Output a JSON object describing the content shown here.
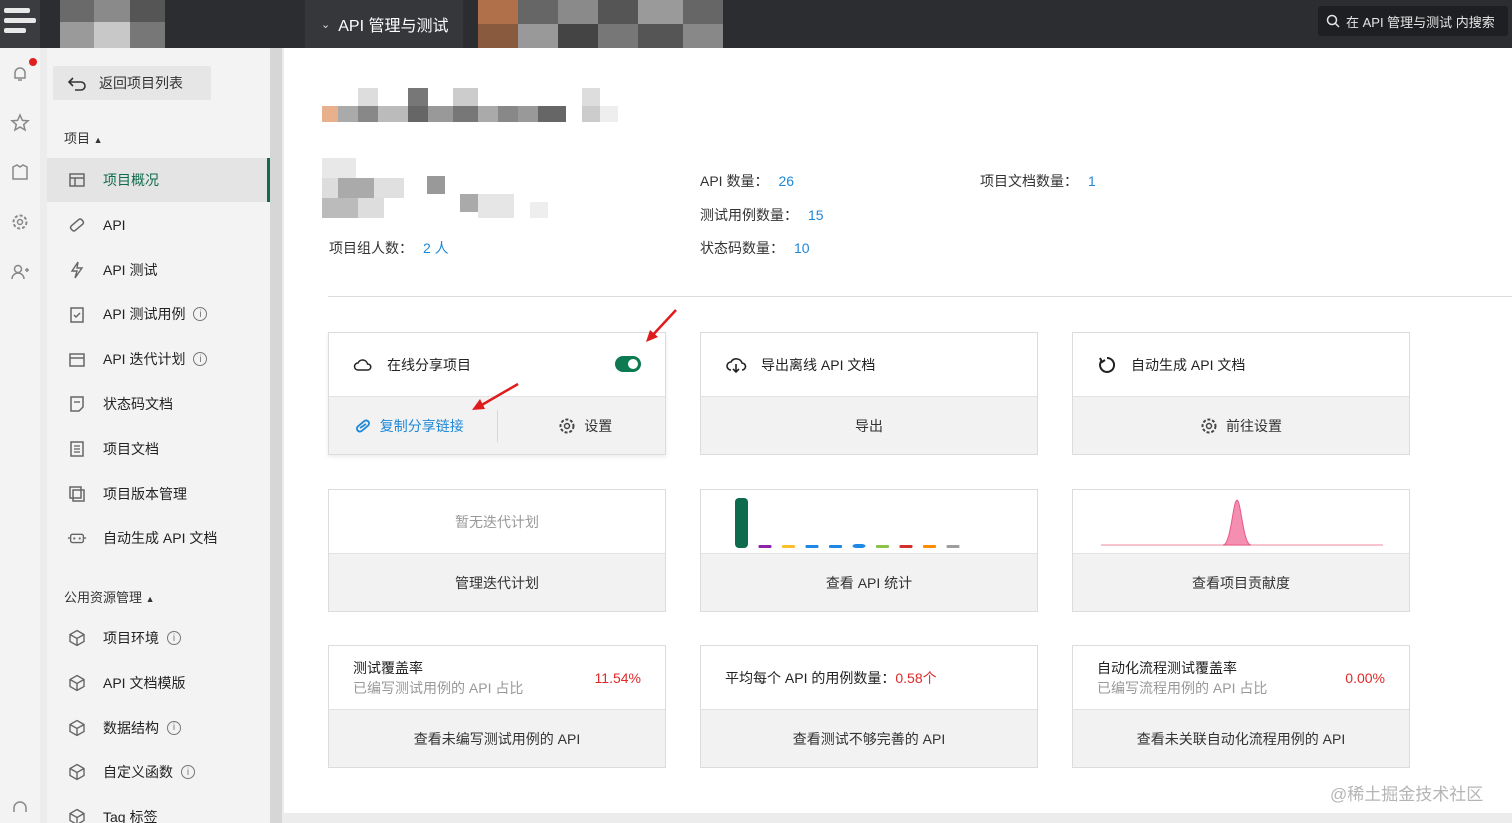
{
  "topbar": {
    "project_title": "API 管理与测试",
    "search_placeholder": "在 API 管理与测试 内搜索"
  },
  "sidebar": {
    "back_label": "返回项目列表",
    "section_project": "项目",
    "project_items": [
      {
        "label": "项目概况",
        "icon": "overview-icon",
        "active": true,
        "info": false
      },
      {
        "label": "API",
        "icon": "api-icon",
        "active": false,
        "info": false
      },
      {
        "label": "API 测试",
        "icon": "lightning-icon",
        "active": false,
        "info": false
      },
      {
        "label": "API 测试用例",
        "icon": "clipboard-check-icon",
        "active": false,
        "info": true
      },
      {
        "label": "API 迭代计划",
        "icon": "calendar-icon",
        "active": false,
        "info": true
      },
      {
        "label": "状态码文档",
        "icon": "document-icon",
        "active": false,
        "info": false
      },
      {
        "label": "项目文档",
        "icon": "list-doc-icon",
        "active": false,
        "info": false
      },
      {
        "label": "项目版本管理",
        "icon": "versions-icon",
        "active": false,
        "info": false
      },
      {
        "label": "自动生成 API 文档",
        "icon": "robot-icon",
        "active": false,
        "info": false
      }
    ],
    "section_public": "公用资源管理",
    "public_items": [
      {
        "label": "项目环境",
        "icon": "cube-icon",
        "info": true
      },
      {
        "label": "API 文档模版",
        "icon": "cube-icon",
        "info": false
      },
      {
        "label": "数据结构",
        "icon": "cube-icon",
        "info": true
      },
      {
        "label": "自定义函数",
        "icon": "cube-icon",
        "info": true
      },
      {
        "label": "Tag 标签",
        "icon": "cube-icon",
        "info": false
      }
    ]
  },
  "stats": {
    "members_label": "项目组人数：",
    "members_value": "2 人",
    "api_count_label": "API 数量：",
    "api_count_value": "26",
    "test_cases_label": "测试用例数量：",
    "test_cases_value": "15",
    "status_codes_label": "状态码数量：",
    "status_codes_value": "10",
    "docs_label": "项目文档数量：",
    "docs_value": "1"
  },
  "cards": {
    "share": {
      "title": "在线分享项目",
      "copy_link": "复制分享链接",
      "settings": "设置",
      "enabled": true
    },
    "export": {
      "title": "导出离线 API 文档",
      "action": "导出"
    },
    "autogen": {
      "title": "自动生成 API 文档",
      "action": "前往设置"
    },
    "iteration": {
      "empty": "暂无迭代计划",
      "action": "管理迭代计划"
    },
    "api_stats": {
      "action": "查看 API 统计"
    },
    "contribution": {
      "action": "查看项目贡献度"
    },
    "test_coverage": {
      "title": "测试覆盖率",
      "subtitle": "已编写测试用例的 API 占比",
      "value": "11.54%",
      "action": "查看未编写测试用例的 API"
    },
    "avg_cases": {
      "title": "平均每个 API 的用例数量：",
      "value": "0.58个",
      "action": "查看测试不够完善的 API"
    },
    "auto_coverage": {
      "title": "自动化流程测试覆盖率",
      "subtitle": "已编写流程用例的 API 占比",
      "value": "0.00%",
      "action": "查看未关联自动化流程用例的 API"
    }
  },
  "mini_bars": {
    "colors": [
      "#0e6b4d",
      "#8e24aa",
      "#fbc02d",
      "#1e88e5",
      "#1e88e5",
      "#1e88e5",
      "#8bc34a",
      "#d32f2f",
      "#fb8c00",
      "#9e9e9e"
    ],
    "values": [
      1.0,
      0.03,
      0.03,
      0.03,
      0.03,
      0.08,
      0.03,
      0.03,
      0.03,
      0.03
    ]
  },
  "watermark": "@稀土掘金技术社区"
}
